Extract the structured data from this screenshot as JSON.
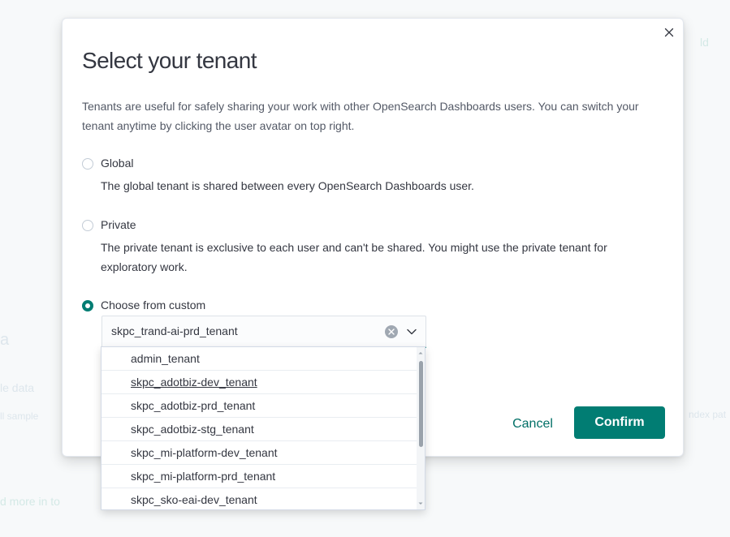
{
  "modal": {
    "title": "Select your tenant",
    "description": "Tenants are useful for safely sharing your work with other OpenSearch Dashboards users. You can switch your tenant anytime by clicking the user avatar on top right.",
    "close_icon": "close-icon"
  },
  "options": {
    "global": {
      "label": "Global",
      "help": "The global tenant is shared between every OpenSearch Dashboards user.",
      "selected": false
    },
    "private": {
      "label": "Private",
      "help": "The private tenant is exclusive to each user and can't be shared. You might use the private tenant for exploratory work.",
      "selected": false
    },
    "custom": {
      "label": "Choose from custom",
      "selected": true
    }
  },
  "combo": {
    "value": "skpc_trand-ai-prd_tenant",
    "clear_icon": "clear-icon",
    "arrow_icon": "chevron-down-icon"
  },
  "dropdown": {
    "items": [
      "admin_tenant",
      "skpc_adotbiz-dev_tenant",
      "skpc_adotbiz-prd_tenant",
      "skpc_adotbiz-stg_tenant",
      "skpc_mi-platform-dev_tenant",
      "skpc_mi-platform-prd_tenant",
      "skpc_sko-eai-dev_tenant"
    ],
    "hovered_item": "skpc_adotbiz-dev_tenant"
  },
  "buttons": {
    "cancel_label": "Cancel",
    "confirm_label": "Confirm"
  },
  "colors": {
    "accent": "#017d73",
    "text": "#343741",
    "subdued_text": "#535966"
  }
}
